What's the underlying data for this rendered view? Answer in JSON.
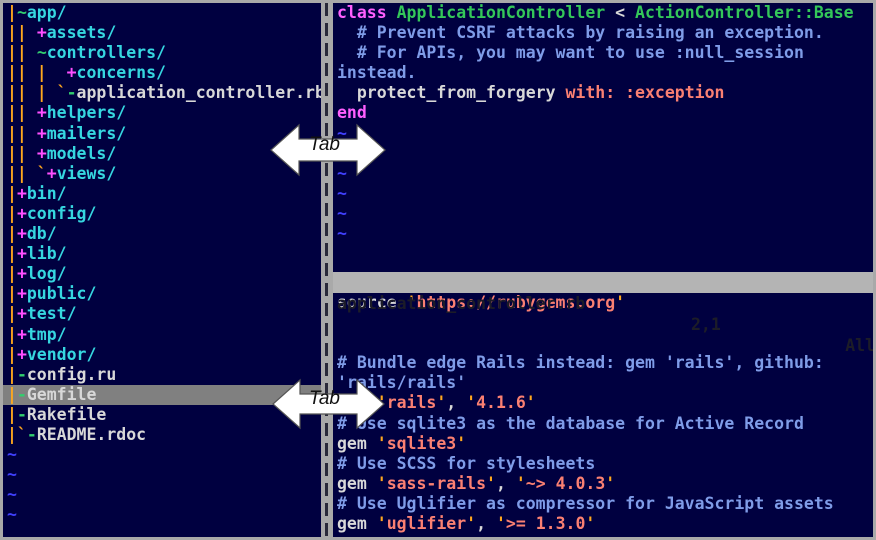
{
  "window": {
    "background_color": "#000040",
    "border_color": "#a9a9a9",
    "divider_color": "#a9a9a9"
  },
  "tree_pane": {
    "name": "nerdtree-file-explorer",
    "rows": [
      {
        "bars": "",
        "marker": "~",
        "marker_type": "open",
        "label": "app/",
        "type": "dir",
        "selected": false
      },
      {
        "bars": "| ",
        "marker": "+",
        "marker_type": "closed",
        "label": "assets/",
        "type": "dir",
        "selected": false
      },
      {
        "bars": "| ",
        "marker": "~",
        "marker_type": "open",
        "label": "controllers/",
        "type": "dir",
        "selected": false
      },
      {
        "bars": "| |  ",
        "marker": "+",
        "marker_type": "closed",
        "label": "concerns/",
        "type": "dir",
        "selected": false
      },
      {
        "bars": "| | `",
        "marker": "-",
        "marker_type": "file",
        "label": "application_controller.rb",
        "type": "file",
        "selected": false
      },
      {
        "bars": "| ",
        "marker": "+",
        "marker_type": "closed",
        "label": "helpers/",
        "type": "dir",
        "selected": false
      },
      {
        "bars": "| ",
        "marker": "+",
        "marker_type": "closed",
        "label": "mailers/",
        "type": "dir",
        "selected": false
      },
      {
        "bars": "| ",
        "marker": "+",
        "marker_type": "closed",
        "label": "models/",
        "type": "dir",
        "selected": false
      },
      {
        "bars": "| `",
        "marker": "+",
        "marker_type": "closed",
        "label": "views/",
        "type": "dir",
        "selected": false
      },
      {
        "bars": "",
        "marker": "+",
        "marker_type": "closed",
        "label": "bin/",
        "type": "dir",
        "selected": false
      },
      {
        "bars": "",
        "marker": "+",
        "marker_type": "closed",
        "label": "config/",
        "type": "dir",
        "selected": false
      },
      {
        "bars": "",
        "marker": "+",
        "marker_type": "closed",
        "label": "db/",
        "type": "dir",
        "selected": false
      },
      {
        "bars": "",
        "marker": "+",
        "marker_type": "closed",
        "label": "lib/",
        "type": "dir",
        "selected": false
      },
      {
        "bars": "",
        "marker": "+",
        "marker_type": "closed",
        "label": "log/",
        "type": "dir",
        "selected": false
      },
      {
        "bars": "",
        "marker": "+",
        "marker_type": "closed",
        "label": "public/",
        "type": "dir",
        "selected": false
      },
      {
        "bars": "",
        "marker": "+",
        "marker_type": "closed",
        "label": "test/",
        "type": "dir",
        "selected": false
      },
      {
        "bars": "",
        "marker": "+",
        "marker_type": "closed",
        "label": "tmp/",
        "type": "dir",
        "selected": false
      },
      {
        "bars": "",
        "marker": "+",
        "marker_type": "closed",
        "label": "vendor/",
        "type": "dir",
        "selected": false
      },
      {
        "bars": "",
        "marker": "-",
        "marker_type": "file",
        "label": "config.ru",
        "type": "file",
        "selected": false
      },
      {
        "bars": "",
        "marker": "-",
        "marker_type": "file",
        "label": "Gemfile",
        "type": "file",
        "selected": true
      },
      {
        "bars": "",
        "marker": "-",
        "marker_type": "file",
        "label": "Rakefile",
        "type": "file",
        "selected": false
      },
      {
        "bars": "`",
        "marker": "-",
        "marker_type": "file",
        "label": "README.rdoc",
        "type": "file",
        "selected": false
      }
    ],
    "empty_rows": 4,
    "empty_marker": "~"
  },
  "top_pane": {
    "name": "application-controller-buffer",
    "lines": [
      [
        {
          "t": "class ",
          "c": "keyword"
        },
        {
          "t": "ApplicationController ",
          "c": "const"
        },
        {
          "t": "< ",
          "c": "op"
        },
        {
          "t": "ActionController::Base",
          "c": "const"
        }
      ],
      [
        {
          "t": "  # Prevent CSRF attacks by raising an exception.",
          "c": "comment"
        }
      ],
      [
        {
          "t": "  # For APIs, you may want to use :null_session",
          "c": "comment"
        }
      ],
      [
        {
          "t": "instead.",
          "c": "comment"
        }
      ],
      [
        {
          "t": "  protect_from_forgery ",
          "c": "ident"
        },
        {
          "t": "with: ",
          "c": "string"
        },
        {
          "t": ":exception",
          "c": "string"
        }
      ],
      [
        {
          "t": "end",
          "c": "keyword"
        }
      ]
    ],
    "empty_rows": 6,
    "empty_marker": "~"
  },
  "status_bar": {
    "name": "status-line",
    "filename": "application_controller.rb",
    "position": "2,1",
    "percent": "All"
  },
  "bottom_pane": {
    "name": "gemfile-buffer",
    "lines": [
      [
        {
          "t": "source ",
          "c": "ident"
        },
        {
          "t": "'",
          "c": "quote"
        },
        {
          "t": "https://rubygems.org",
          "c": "string"
        },
        {
          "t": "'",
          "c": "quote"
        }
      ],
      [],
      [],
      [
        {
          "t": "# Bundle edge Rails instead: gem 'rails', github:",
          "c": "comment"
        }
      ],
      [
        {
          "t": "'rails/rails'",
          "c": "comment"
        }
      ],
      [
        {
          "t": "gem ",
          "c": "ident"
        },
        {
          "t": "'",
          "c": "quote"
        },
        {
          "t": "rails",
          "c": "string"
        },
        {
          "t": "'",
          "c": "quote"
        },
        {
          "t": ", ",
          "c": "op"
        },
        {
          "t": "'",
          "c": "quote"
        },
        {
          "t": "4.1.6",
          "c": "string"
        },
        {
          "t": "'",
          "c": "quote"
        }
      ],
      [
        {
          "t": "# Use sqlite3 as the database for Active Record",
          "c": "comment"
        }
      ],
      [
        {
          "t": "gem ",
          "c": "ident"
        },
        {
          "t": "'",
          "c": "quote"
        },
        {
          "t": "sqlite3",
          "c": "string"
        },
        {
          "t": "'",
          "c": "quote"
        }
      ],
      [
        {
          "t": "# Use SCSS for stylesheets",
          "c": "comment"
        }
      ],
      [
        {
          "t": "gem ",
          "c": "ident"
        },
        {
          "t": "'",
          "c": "quote"
        },
        {
          "t": "sass-rails",
          "c": "string"
        },
        {
          "t": "'",
          "c": "quote"
        },
        {
          "t": ", ",
          "c": "op"
        },
        {
          "t": "'",
          "c": "quote"
        },
        {
          "t": "~> 4.0.3",
          "c": "string"
        },
        {
          "t": "'",
          "c": "quote"
        }
      ],
      [
        {
          "t": "# Use Uglifier as compressor for JavaScript assets",
          "c": "comment"
        }
      ],
      [
        {
          "t": "gem ",
          "c": "ident"
        },
        {
          "t": "'",
          "c": "quote"
        },
        {
          "t": "uglifier",
          "c": "string"
        },
        {
          "t": "'",
          "c": "quote"
        },
        {
          "t": ", ",
          "c": "op"
        },
        {
          "t": "'",
          "c": "quote"
        },
        {
          "t": ">= 1.3.0",
          "c": "string"
        },
        {
          "t": "'",
          "c": "quote"
        }
      ]
    ]
  },
  "annotations": [
    {
      "name": "tab-arrow-top",
      "label": "Tab"
    },
    {
      "name": "tab-arrow-bottom",
      "label": "Tab"
    }
  ]
}
